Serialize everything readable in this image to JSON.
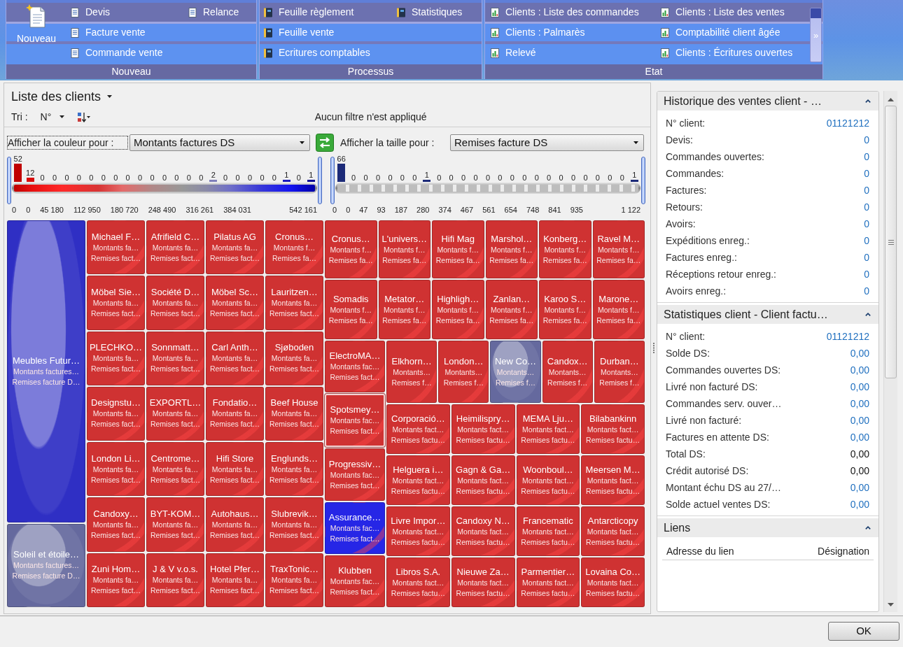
{
  "ribbon": {
    "groups": [
      {
        "label": "Nouveau",
        "large_button": "Nouveau",
        "button_stacks": [
          [
            "Devis",
            "Facture vente",
            "Commande vente"
          ],
          [
            "Relance"
          ]
        ]
      },
      {
        "label": "Processus",
        "button_stacks": [
          [
            "Feuille règlement",
            "Feuille vente",
            "Ecritures comptables"
          ],
          [
            "Statistiques"
          ]
        ]
      },
      {
        "label": "Etat",
        "button_stacks": [
          [
            "Clients : Liste des commandes",
            "Clients : Palmarès",
            "Relevé"
          ],
          [
            "Clients : Liste des ventes",
            "Comptabilité client âgée",
            "Clients : Écritures ouvertes"
          ]
        ]
      }
    ],
    "more_button": "»"
  },
  "list": {
    "title": "Liste des clients",
    "sort_label": "Tri :",
    "sort_field": "N°",
    "filter_status": "Aucun filtre n'est appliqué",
    "color_by": {
      "label": "Afficher la couleur pour :",
      "value": "Montants factures DS",
      "focused": true
    },
    "size_by": {
      "label": "Afficher la taille pour :",
      "value": "Remises facture DS",
      "focused": false
    },
    "color_legend": {
      "counts": [
        "52",
        "12",
        "0",
        "0",
        "0",
        "0",
        "0",
        "0",
        "0",
        "0",
        "0",
        "0",
        "0",
        "0",
        "0",
        "0",
        "2",
        "0",
        "0",
        "0",
        "0",
        "0",
        "1",
        "0",
        "1"
      ],
      "ticks": [
        "0",
        "0",
        "45 180",
        "112 950",
        "180 720",
        "248 490",
        "316 261",
        "384 031",
        "542 161"
      ]
    },
    "size_legend": {
      "counts": [
        "66",
        "0",
        "0",
        "0",
        "0",
        "0",
        "0",
        "1",
        "0",
        "0",
        "0",
        "0",
        "0",
        "0",
        "0",
        "0",
        "0",
        "0",
        "0",
        "0",
        "0",
        "0",
        "0",
        "0",
        "1"
      ],
      "ticks": [
        "0",
        "0",
        "47",
        "93",
        "187",
        "280",
        "374",
        "467",
        "561",
        "654",
        "748",
        "841",
        "935",
        "1 122"
      ]
    },
    "treemap": {
      "stacks": [
        [
          {
            "name": "Meubles Futur…",
            "line1": "Montants factures…",
            "line2": "Remises facture D…",
            "color": "#2f2fc4",
            "selected": false,
            "glow": true
          },
          {
            "name": "Soleil et étoile…",
            "line1": "Montants factures…",
            "line2": "Remises facture D…",
            "color": "#65699e",
            "selected": false,
            "glow": true
          }
        ],
        [
          {
            "name": "Michael F…",
            "line1": "Montants fa…",
            "line2": "Remises fact…",
            "color": "#cf3232",
            "selected": false,
            "glow": false
          },
          {
            "name": "Möbel Sie…",
            "line1": "Montants fa…",
            "line2": "Remises fact…",
            "color": "#cf3232",
            "selected": false,
            "glow": false
          },
          {
            "name": "PLECHKO…",
            "line1": "Montants fa…",
            "line2": "Remises fact…",
            "color": "#cf3232",
            "selected": false,
            "glow": false
          },
          {
            "name": "Designstu…",
            "line1": "Montants fa…",
            "line2": "Remises fact…",
            "color": "#cf3232",
            "selected": false,
            "glow": false
          },
          {
            "name": "London Li…",
            "line1": "Montants fa…",
            "line2": "Remises fact…",
            "color": "#cf3232",
            "selected": false,
            "glow": false
          },
          {
            "name": "Candoxy…",
            "line1": "Montants fa…",
            "line2": "Remises fact…",
            "color": "#cf3232",
            "selected": false,
            "glow": false
          },
          {
            "name": "Zuni Hom…",
            "line1": "Montants fa…",
            "line2": "Remises fact…",
            "color": "#cf3232",
            "selected": false,
            "glow": false
          }
        ],
        [
          {
            "name": "Afrifield C…",
            "line1": "Montants fa…",
            "line2": "Remises fact…",
            "color": "#cf3232",
            "selected": false,
            "glow": false
          },
          {
            "name": "Société D…",
            "line1": "Montants fa…",
            "line2": "Remises fact…",
            "color": "#cf3232",
            "selected": false,
            "glow": false
          },
          {
            "name": "Sonnmatt…",
            "line1": "Montants fa…",
            "line2": "Remises fact…",
            "color": "#cf3232",
            "selected": false,
            "glow": false
          },
          {
            "name": "EXPORTL…",
            "line1": "Montants fa…",
            "line2": "Remises fact…",
            "color": "#cf3232",
            "selected": false,
            "glow": false
          },
          {
            "name": "Centrome…",
            "line1": "Montants fa…",
            "line2": "Remises fact…",
            "color": "#cf3232",
            "selected": false,
            "glow": false
          },
          {
            "name": "BYT-KOM…",
            "line1": "Montants fa…",
            "line2": "Remises fact…",
            "color": "#cf3232",
            "selected": false,
            "glow": false
          },
          {
            "name": "J & V v.o.s.",
            "line1": "Montants fa…",
            "line2": "Remises fact…",
            "color": "#cf3232",
            "selected": false,
            "glow": false
          }
        ],
        [
          {
            "name": "Pilatus AG",
            "line1": "Montants fa…",
            "line2": "Remises fact…",
            "color": "#cf3232",
            "selected": false,
            "glow": false
          },
          {
            "name": "Möbel Sc…",
            "line1": "Montants fa…",
            "line2": "Remises fact…",
            "color": "#cf3232",
            "selected": false,
            "glow": false
          },
          {
            "name": "Carl Anth…",
            "line1": "Montants fa…",
            "line2": "Remises fact…",
            "color": "#cf3232",
            "selected": false,
            "glow": false
          },
          {
            "name": "Fondatio…",
            "line1": "Montants fa…",
            "line2": "Remises fact…",
            "color": "#cf3232",
            "selected": false,
            "glow": false
          },
          {
            "name": "Hifi Store",
            "line1": "Montants fa…",
            "line2": "Remises fact…",
            "color": "#cf3232",
            "selected": false,
            "glow": false
          },
          {
            "name": "Autohaus…",
            "line1": "Montants fa…",
            "line2": "Remises fact…",
            "color": "#cf3232",
            "selected": false,
            "glow": false
          },
          {
            "name": "Hotel Pfer…",
            "line1": "Montants fa…",
            "line2": "Remises fact…",
            "color": "#cf3232",
            "selected": false,
            "glow": false
          }
        ],
        [
          {
            "name": "Cronus…",
            "line1": "Montants f…",
            "line2": "Remises fa…",
            "color": "#cf3232",
            "selected": false,
            "glow": false
          },
          {
            "name": "Lauritzen…",
            "line1": "Montants fa…",
            "line2": "Remises fact…",
            "color": "#cf3232",
            "selected": false,
            "glow": false
          },
          {
            "name": "Sjøboden",
            "line1": "Montants fa…",
            "line2": "Remises fact…",
            "color": "#cf3232",
            "selected": false,
            "glow": false
          },
          {
            "name": "Beef House",
            "line1": "Montants fa…",
            "line2": "Remises fact…",
            "color": "#cf3232",
            "selected": false,
            "glow": false
          },
          {
            "name": "Englunds…",
            "line1": "Montants fa…",
            "line2": "Remises fact…",
            "color": "#cf3232",
            "selected": false,
            "glow": false
          },
          {
            "name": "Slubrevik…",
            "line1": "Montants fa…",
            "line2": "Remises fact…",
            "color": "#cf3232",
            "selected": false,
            "glow": false
          },
          {
            "name": "TraxTonic…",
            "line1": "Montants fa…",
            "line2": "Remises fact…",
            "color": "#cf3232",
            "selected": false,
            "glow": false
          }
        ]
      ],
      "bands": [
        [
          {
            "name": "Cronus…",
            "line1": "Montants f…",
            "line2": "Remises fa…",
            "color": "#cf3232",
            "selected": false,
            "glow": false
          },
          {
            "name": "L'univers…",
            "line1": "Montants f…",
            "line2": "Remises fa…",
            "color": "#cf3232",
            "selected": false,
            "glow": false
          },
          {
            "name": "Hifi Mag",
            "line1": "Montants f…",
            "line2": "Remises fa…",
            "color": "#cf3232",
            "selected": false,
            "glow": false
          },
          {
            "name": "Marshol…",
            "line1": "Montants f…",
            "line2": "Remises fa…",
            "color": "#cf3232",
            "selected": false,
            "glow": false
          },
          {
            "name": "Konberg…",
            "line1": "Montants f…",
            "line2": "Remises fa…",
            "color": "#cf3232",
            "selected": false,
            "glow": false
          },
          {
            "name": "Ravel M…",
            "line1": "Montants f…",
            "line2": "Remises fa…",
            "color": "#cf3232",
            "selected": false,
            "glow": false
          }
        ],
        [
          {
            "name": "Somadis",
            "line1": "Montants f…",
            "line2": "Remises fa…",
            "color": "#cf3232",
            "selected": false,
            "glow": false
          },
          {
            "name": "Metator…",
            "line1": "Montants f…",
            "line2": "Remises fa…",
            "color": "#cf3232",
            "selected": false,
            "glow": false
          },
          {
            "name": "Highligh…",
            "line1": "Montants f…",
            "line2": "Remises fa…",
            "color": "#cf3232",
            "selected": false,
            "glow": false
          },
          {
            "name": "Zanlan…",
            "line1": "Montants f…",
            "line2": "Remises fa…",
            "color": "#cf3232",
            "selected": false,
            "glow": false
          },
          {
            "name": "Karoo S…",
            "line1": "Montants f…",
            "line2": "Remises fa…",
            "color": "#cf3232",
            "selected": false,
            "glow": false
          },
          {
            "name": "Marone…",
            "line1": "Montants f…",
            "line2": "Remises fa…",
            "color": "#cf3232",
            "selected": false,
            "glow": false
          }
        ]
      ],
      "side_stack": [
        {
          "name": "ElectroMA…",
          "line1": "Montants fac…",
          "line2": "Remises fact…",
          "color": "#cf3232",
          "selected": false,
          "glow": false
        },
        {
          "name": "Spotsmey…",
          "line1": "Montants fac…",
          "line2": "Remises fact…",
          "color": "#cf3232",
          "selected": true,
          "glow": false
        },
        {
          "name": "Progressiv…",
          "line1": "Montants fac…",
          "line2": "Remises fact…",
          "color": "#cf3232",
          "selected": false,
          "glow": false
        },
        {
          "name": "Assurance…",
          "line1": "Montants fac…",
          "line2": "Remises fact…",
          "color": "#2626e6",
          "selected": false,
          "glow": false
        },
        {
          "name": "Klubben",
          "line1": "Montants fac…",
          "line2": "Remises fact…",
          "color": "#cf3232",
          "selected": false,
          "glow": false
        }
      ],
      "strip": [
        {
          "name": "Elkhorn…",
          "line1": "Montants…",
          "line2": "Remises f…",
          "color": "#cf3232",
          "selected": false,
          "glow": false
        },
        {
          "name": "London…",
          "line1": "Montants…",
          "line2": "Remises f…",
          "color": "#cf3232",
          "selected": false,
          "glow": false
        },
        {
          "name": "New Co…",
          "line1": "Montants…",
          "line2": "Remises f…",
          "color": "#65699e",
          "selected": false,
          "glow": true
        },
        {
          "name": "Candox…",
          "line1": "Montants…",
          "line2": "Remises f…",
          "color": "#cf3232",
          "selected": false,
          "glow": false
        },
        {
          "name": "Durban…",
          "line1": "Montants…",
          "line2": "Remises f…",
          "color": "#cf3232",
          "selected": false,
          "glow": false
        }
      ],
      "block": [
        {
          "name": "Corporació…",
          "line1": "Montants fact…",
          "line2": "Remises factu…",
          "color": "#cf3232",
          "selected": false,
          "glow": false
        },
        {
          "name": "Heimilispry…",
          "line1": "Montants fact…",
          "line2": "Remises factu…",
          "color": "#cf3232",
          "selected": false,
          "glow": false
        },
        {
          "name": "MEMA Lju…",
          "line1": "Montants fact…",
          "line2": "Remises factu…",
          "color": "#cf3232",
          "selected": false,
          "glow": false
        },
        {
          "name": "Bilabankinn",
          "line1": "Montants fact…",
          "line2": "Remises factu…",
          "color": "#cf3232",
          "selected": false,
          "glow": false
        },
        {
          "name": "Helguera i…",
          "line1": "Montants fact…",
          "line2": "Remises factu…",
          "color": "#cf3232",
          "selected": false,
          "glow": false
        },
        {
          "name": "Gagn & Ga…",
          "line1": "Montants fact…",
          "line2": "Remises factu…",
          "color": "#cf3232",
          "selected": false,
          "glow": false
        },
        {
          "name": "Woonboul…",
          "line1": "Montants fact…",
          "line2": "Remises factu…",
          "color": "#cf3232",
          "selected": false,
          "glow": false
        },
        {
          "name": "Meersen M…",
          "line1": "Montants fact…",
          "line2": "Remises factu…",
          "color": "#cf3232",
          "selected": false,
          "glow": false
        },
        {
          "name": "Livre Impor…",
          "line1": "Montants fact…",
          "line2": "Remises factu…",
          "color": "#cf3232",
          "selected": false,
          "glow": false
        },
        {
          "name": "Candoxy N…",
          "line1": "Montants fact…",
          "line2": "Remises factu…",
          "color": "#cf3232",
          "selected": false,
          "glow": false
        },
        {
          "name": "Francematic",
          "line1": "Montants fact…",
          "line2": "Remises factu…",
          "color": "#cf3232",
          "selected": false,
          "glow": false
        },
        {
          "name": "Antarcticopy",
          "line1": "Montants fact…",
          "line2": "Remises factu…",
          "color": "#cf3232",
          "selected": false,
          "glow": false
        },
        {
          "name": "Libros S.A.",
          "line1": "Montants fact…",
          "line2": "Remises factu…",
          "color": "#cf3232",
          "selected": false,
          "glow": false
        },
        {
          "name": "Nieuwe Za…",
          "line1": "Montants fact…",
          "line2": "Remises factu…",
          "color": "#cf3232",
          "selected": false,
          "glow": false
        },
        {
          "name": "Parmentier…",
          "line1": "Montants fact…",
          "line2": "Remises factu…",
          "color": "#cf3232",
          "selected": false,
          "glow": false
        },
        {
          "name": "Lovaina Co…",
          "line1": "Montants fact…",
          "line2": "Remises factu…",
          "color": "#cf3232",
          "selected": false,
          "glow": false
        }
      ]
    }
  },
  "factbox": {
    "sections": [
      {
        "title": "Historique des ventes client - …",
        "expanded": true,
        "rows": [
          {
            "label": "N° client:",
            "value": "01121212",
            "link": true
          },
          {
            "label": "Devis:",
            "value": "0",
            "link": true
          },
          {
            "label": "Commandes ouvertes:",
            "value": "0",
            "link": true
          },
          {
            "label": "Commandes:",
            "value": "0",
            "link": true
          },
          {
            "label": "Factures:",
            "value": "0",
            "link": true
          },
          {
            "label": "Retours:",
            "value": "0",
            "link": true
          },
          {
            "label": "Avoirs:",
            "value": "0",
            "link": true
          },
          {
            "label": "Expéditions enreg.:",
            "value": "0",
            "link": true
          },
          {
            "label": "Factures enreg.:",
            "value": "0",
            "link": true
          },
          {
            "label": "Réceptions retour enreg.:",
            "value": "0",
            "link": true
          },
          {
            "label": "Avoirs enreg.:",
            "value": "0",
            "link": true
          }
        ]
      },
      {
        "title": "Statistiques client - Client factu…",
        "expanded": true,
        "rows": [
          {
            "label": "N° client:",
            "value": "01121212",
            "link": true
          },
          {
            "label": "Solde DS:",
            "value": "0,00",
            "link": true
          },
          {
            "label": "Commandes ouvertes DS:",
            "value": "0,00",
            "link": true
          },
          {
            "label": "Livré non facturé DS:",
            "value": "0,00",
            "link": true
          },
          {
            "label": "Commandes serv. ouver…",
            "value": "0,00",
            "link": true
          },
          {
            "label": "Livré non facturé:",
            "value": "0,00",
            "link": true
          },
          {
            "label": "Factures en attente DS:",
            "value": "0,00",
            "link": true
          },
          {
            "label": "Total DS:",
            "value": "0,00",
            "link": false
          },
          {
            "label": "Crédit autorisé DS:",
            "value": "0,00",
            "link": false
          },
          {
            "label": "Montant échu DS au 27/…",
            "value": "0,00",
            "link": true
          },
          {
            "label": "Solde actuel ventes DS:",
            "value": "0,00",
            "link": true
          }
        ]
      },
      {
        "title": "Liens",
        "expanded": true,
        "columns": [
          "Adresse du lien",
          "Désignation"
        ]
      }
    ]
  },
  "footer": {
    "ok_button": "OK"
  }
}
